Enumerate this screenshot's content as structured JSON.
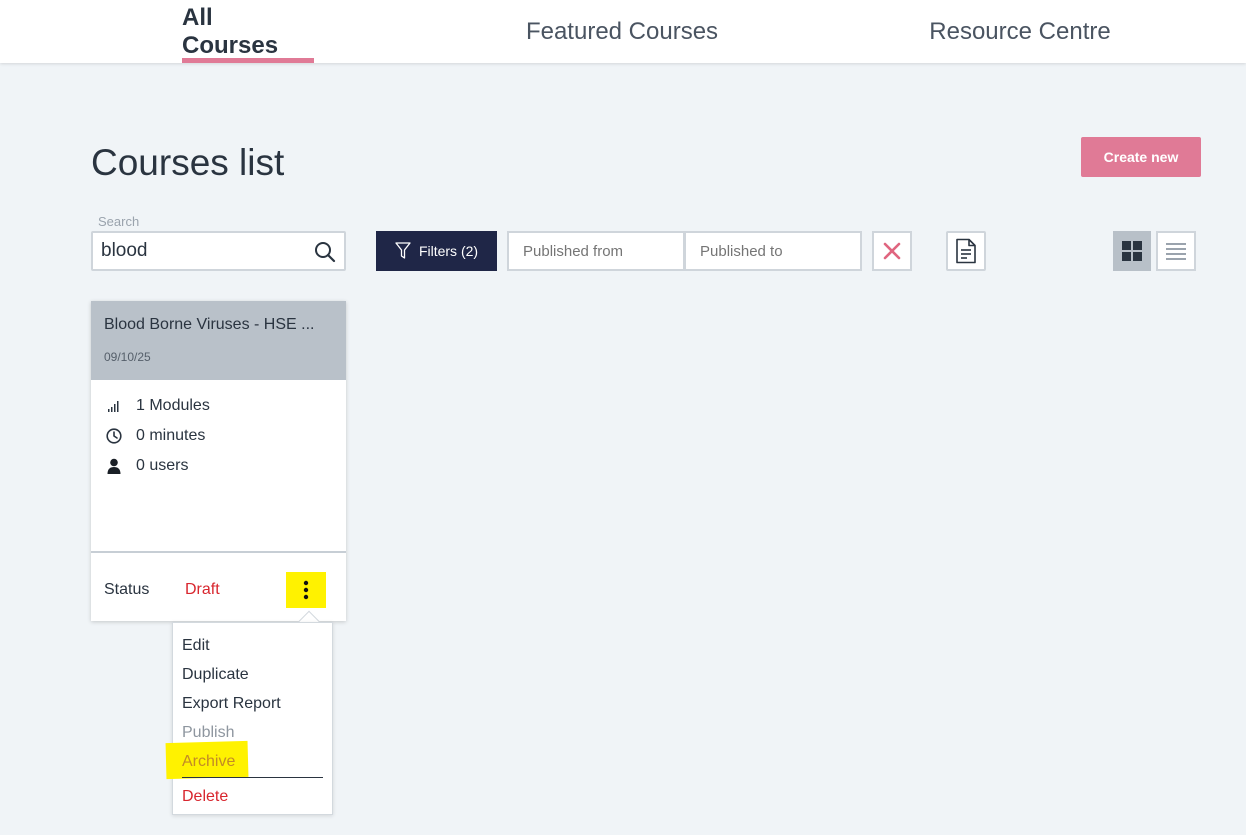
{
  "nav": {
    "tabs": [
      {
        "label": "All Courses",
        "active": true
      },
      {
        "label": "Featured Courses",
        "active": false
      },
      {
        "label": "Resource Centre",
        "active": false
      }
    ]
  },
  "page": {
    "title": "Courses list",
    "create_button": "Create new"
  },
  "toolbar": {
    "search_label": "Search",
    "search_value": "blood",
    "filters_label": "Filters (2)",
    "published_from_placeholder": "Published from",
    "published_to_placeholder": "Published to"
  },
  "courses": [
    {
      "title": "Blood Borne Viruses - HSE ...",
      "date": "09/10/25",
      "modules": "1 Modules",
      "duration": "0 minutes",
      "users": "0 users",
      "status_label": "Status",
      "status_value": "Draft"
    }
  ],
  "menu": {
    "items": [
      "Edit",
      "Duplicate",
      "Export Report",
      "Publish",
      "Archive",
      "Delete"
    ]
  },
  "colors": {
    "accent": "#e07a96",
    "dark_button": "#1f2647",
    "highlight": "#fff200",
    "status_draft": "#d8262e"
  }
}
